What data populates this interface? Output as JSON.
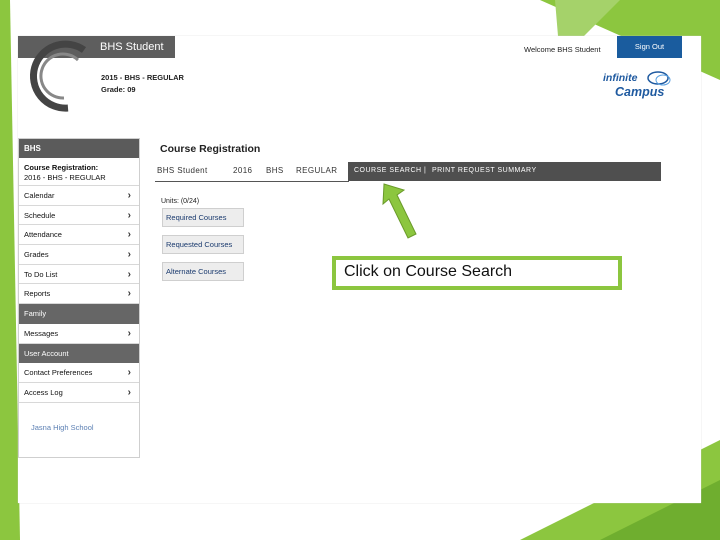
{
  "app": {
    "title": "BHS Student",
    "term_line1": "2015 - BHS - REGULAR",
    "term_line2": "Grade: 09",
    "welcome": "Welcome BHS Student",
    "signout": "Sign Out",
    "logo_line1": "infinite",
    "logo_line2": "Campus"
  },
  "sidebar": {
    "header": "BHS",
    "course_line1": "Course Registration:",
    "course_line2": "2016 - BHS - REGULAR",
    "items": [
      {
        "label": "Calendar"
      },
      {
        "label": "Schedule"
      },
      {
        "label": "Attendance"
      },
      {
        "label": "Grades"
      },
      {
        "label": "To Do List"
      },
      {
        "label": "Reports"
      }
    ],
    "family_header": "Family",
    "family_items": [
      {
        "label": "Messages"
      }
    ],
    "account_header": "User Account",
    "account_items": [
      {
        "label": "Contact Preferences"
      },
      {
        "label": "Access Log"
      }
    ],
    "school": "Jasna High School"
  },
  "main": {
    "title": "Course Registration",
    "tabs": [
      "BHS Student",
      "2016",
      "BHS",
      "REGULAR"
    ],
    "active_tabs": [
      "COURSE SEARCH",
      "|",
      "PRINT REQUEST SUMMARY"
    ],
    "units": "Units: (0/24)",
    "buttons": [
      "Required Courses",
      "Requested Courses",
      "Alternate Courses"
    ]
  },
  "callout": {
    "text": "Click on Course Search",
    "color": "#8cc63f"
  }
}
